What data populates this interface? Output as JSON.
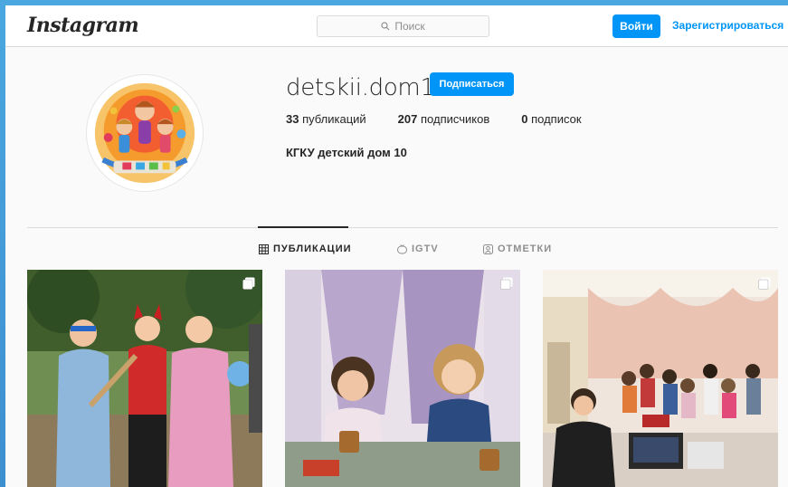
{
  "header": {
    "logo_text": "Instagram",
    "search_placeholder": "Поиск",
    "login_label": "Войти",
    "register_label": "Зарегистрироваться"
  },
  "profile": {
    "username": "detskii.dom10",
    "follow_label": "Подписаться",
    "posts_count": "33",
    "posts_label": "публикаций",
    "followers_count": "207",
    "followers_label": "подписчиков",
    "following_count": "0",
    "following_label": "подписок",
    "full_name": "КГКУ детский дом 10"
  },
  "tabs": [
    {
      "label": "ПУБЛИКАЦИИ",
      "icon": "grid-icon",
      "active": true
    },
    {
      "label": "IGTV",
      "icon": "tv-icon",
      "active": false
    },
    {
      "label": "ОТМЕТКИ",
      "icon": "tagged-icon",
      "active": false
    }
  ],
  "posts": [
    {
      "description_icon": "multiple-photos-icon"
    },
    {
      "description_icon": "multiple-photos-icon"
    },
    {
      "description_icon": "multiple-photos-icon"
    }
  ],
  "colors": {
    "accent": "#0095f6",
    "text": "#262626",
    "muted": "#8e8e8e",
    "border": "#dbdbdb",
    "background": "#fafafa"
  }
}
